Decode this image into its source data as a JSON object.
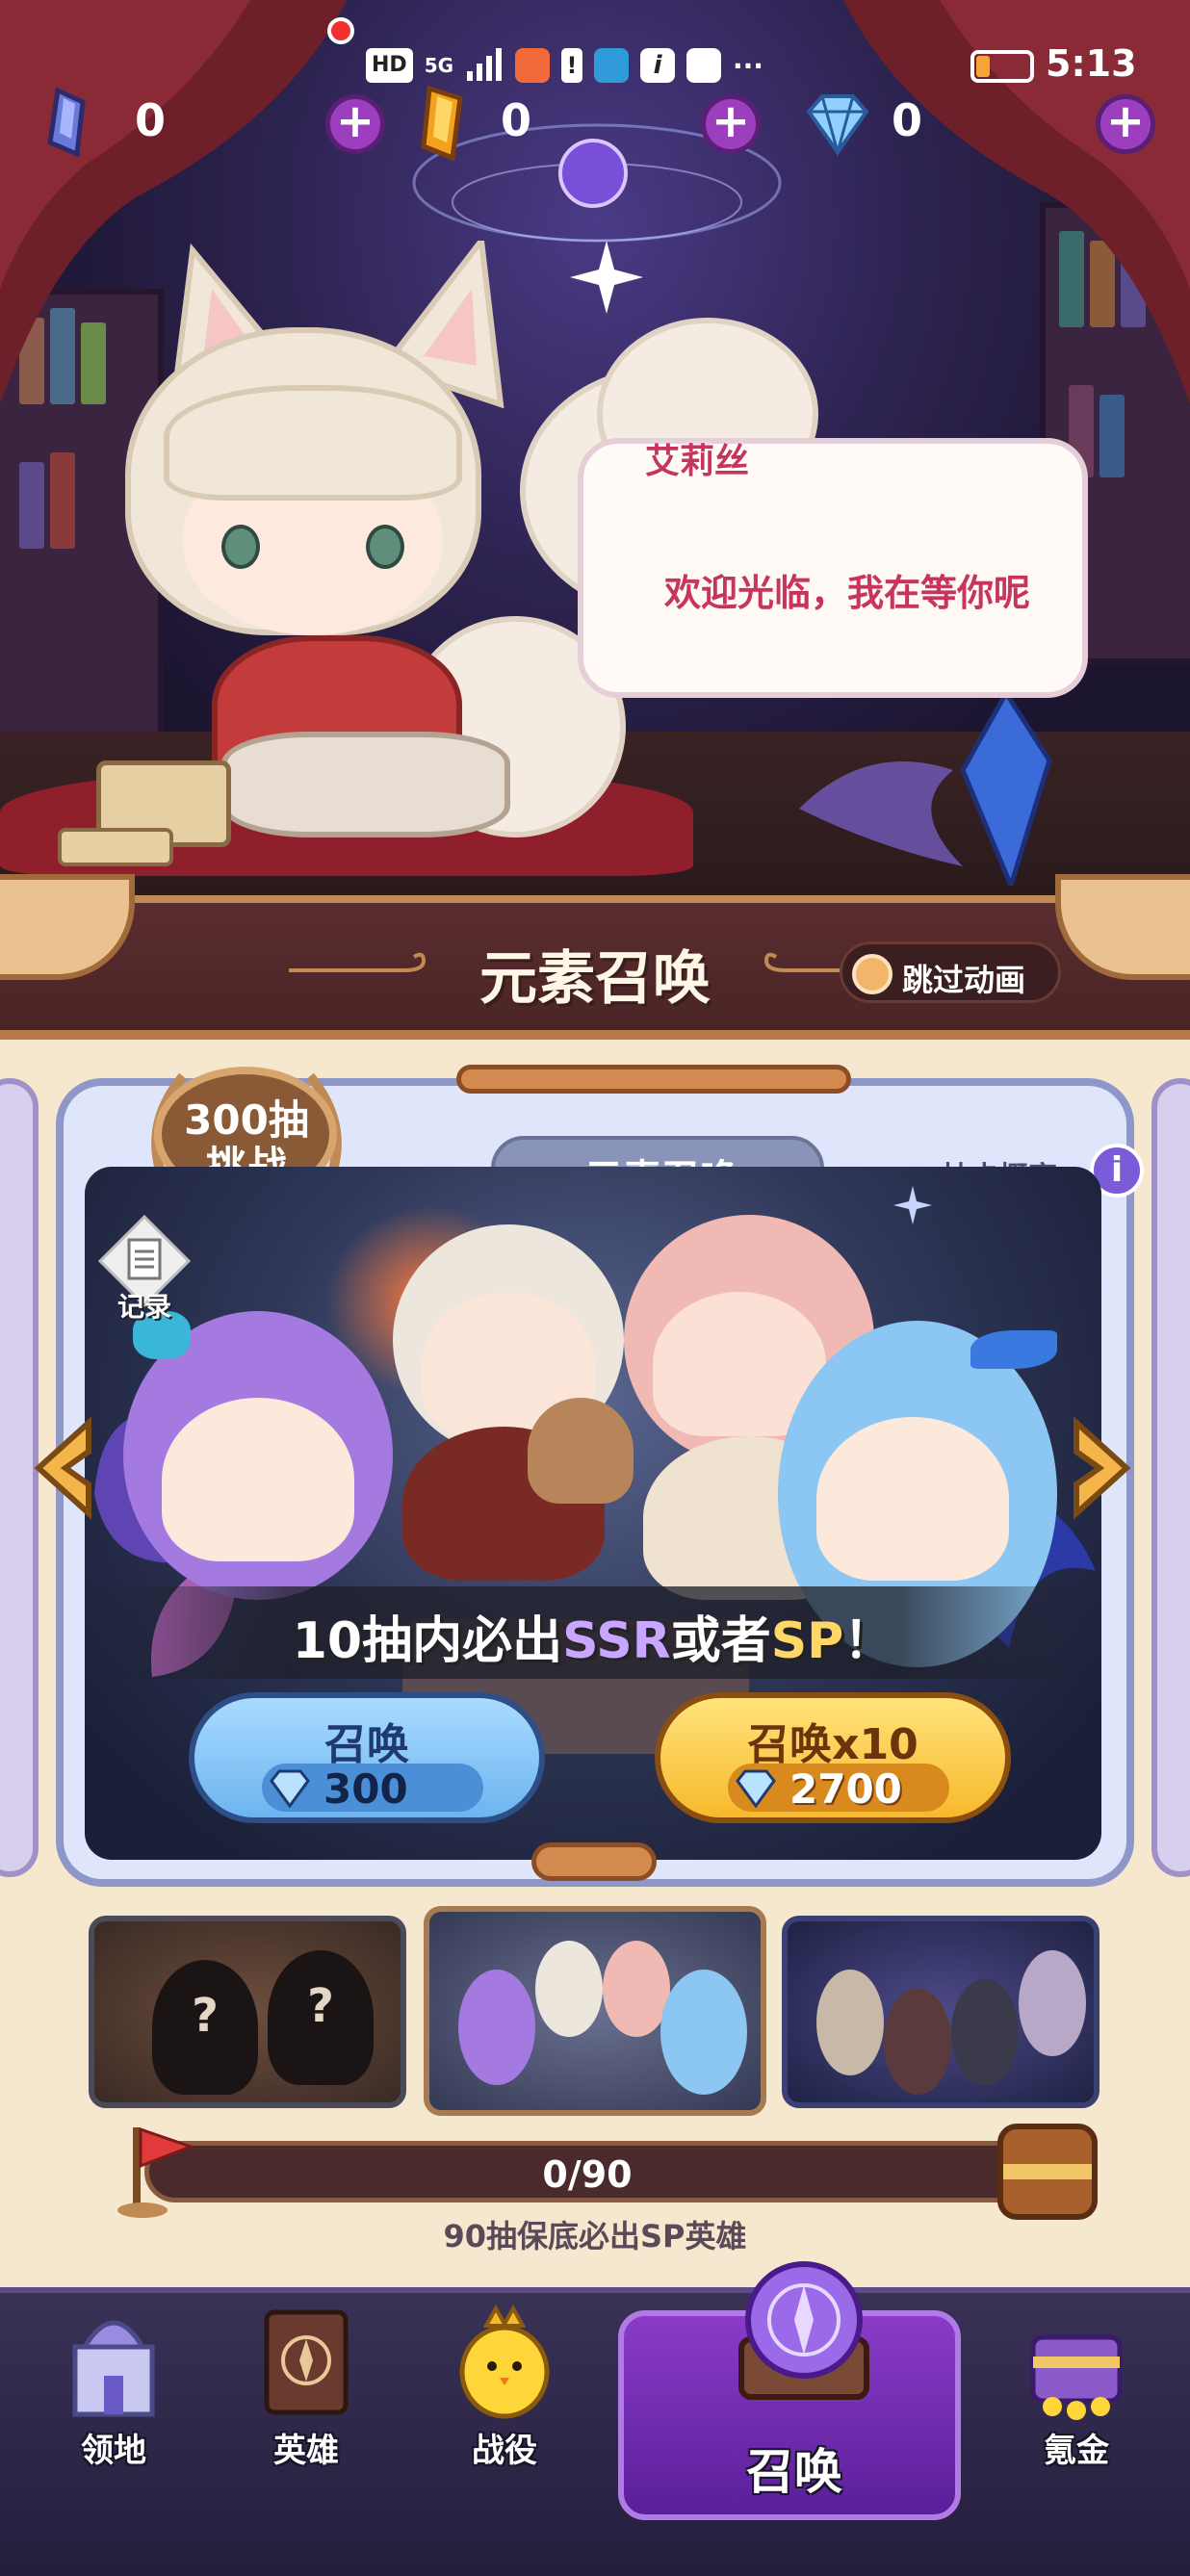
{
  "status_bar": {
    "icons": [
      "HD",
      "5G",
      "signal",
      "app",
      "alert",
      "book",
      "info",
      "bag",
      "···"
    ],
    "time": "5:13",
    "battery": "low"
  },
  "currencies": [
    {
      "name": "crystal",
      "icon": "purple-crystal-icon",
      "value": "0"
    },
    {
      "name": "gold",
      "icon": "gold-crystal-icon",
      "value": "0"
    },
    {
      "name": "diamond",
      "icon": "diamond-icon",
      "value": "0"
    }
  ],
  "dialog": {
    "speaker": "艾莉丝",
    "text": "欢迎光临，我在等你呢"
  },
  "header": {
    "title": "元素召唤",
    "skip_label": "跳过动画"
  },
  "banner": {
    "badge_line1": "300抽",
    "badge_line2": "挑战",
    "title": "元素召唤",
    "rate_label": "抽卡概率",
    "info_symbol": "i",
    "record_label": "记录",
    "caption_prefix": "10抽内必出",
    "caption_ssr": "SSR",
    "caption_mid": "或者",
    "caption_sp": "SP",
    "caption_suffix": "！",
    "summon_single": {
      "label": "召唤",
      "cost": "300"
    },
    "summon_ten": {
      "label": "召唤x10",
      "cost": "2700"
    }
  },
  "thumbnails": [
    {
      "name": "mystery-banner",
      "marks": [
        "?",
        "?"
      ]
    },
    {
      "name": "element-banner"
    },
    {
      "name": "dark-banner"
    }
  ],
  "pity": {
    "current": 0,
    "max": 90,
    "progress_text": "0/90",
    "note": "90抽保底必出SP英雄"
  },
  "nav": [
    {
      "key": "territory",
      "label": "领地",
      "icon": "castle-icon"
    },
    {
      "key": "hero",
      "label": "英雄",
      "icon": "spellbook-icon"
    },
    {
      "key": "battle",
      "label": "战役",
      "icon": "chick-knight-icon"
    },
    {
      "key": "summon",
      "label": "召唤",
      "icon": "summon-altar-icon",
      "active": true
    },
    {
      "key": "shop",
      "label": "氪金",
      "icon": "treasure-chest-icon"
    }
  ],
  "colors": {
    "accent_purple": "#8a3bc8",
    "gold": "#f7b92c",
    "sky": "#6db4f0",
    "ssr_purple": "#c9a6ff",
    "sp_yellow": "#ffd766"
  }
}
